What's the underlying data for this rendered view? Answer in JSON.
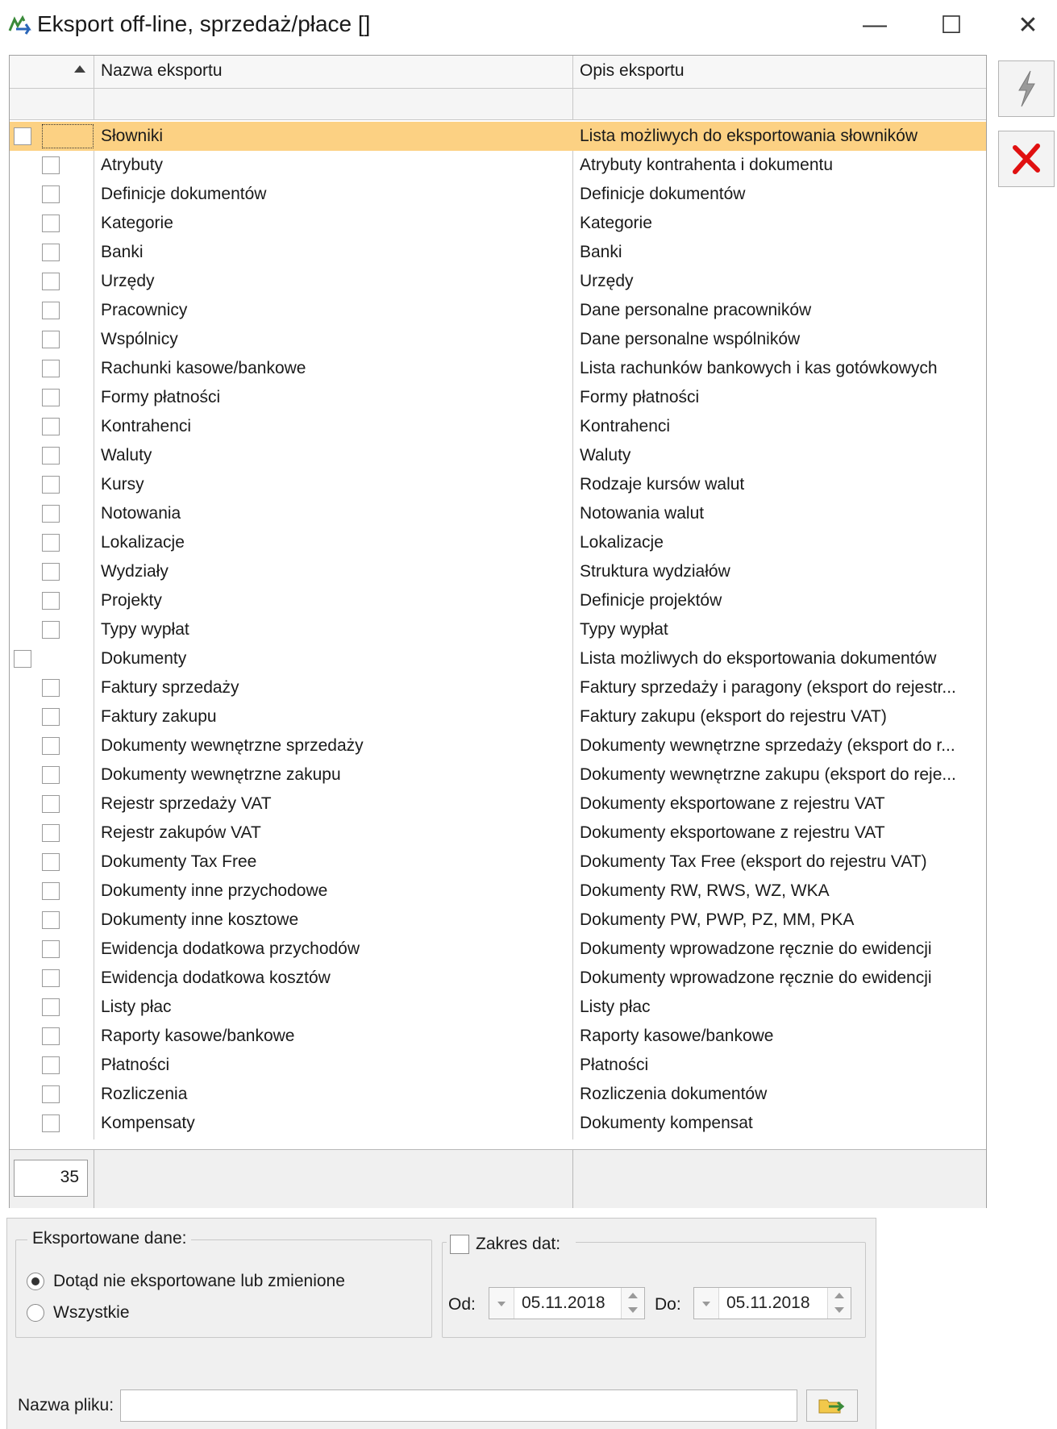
{
  "window": {
    "title": "Eksport off-line, sprzedaż/płace []",
    "minimize": "—",
    "maximize": "☐",
    "close": "✕"
  },
  "grid": {
    "columns": [
      "Nazwa eksportu",
      "Opis eksportu"
    ],
    "rows": [
      {
        "name": "Słowniki",
        "desc": "Lista możliwych do eksportowania słowników"
      },
      {
        "name": "Atrybuty",
        "desc": "Atrybuty kontrahenta i dokumentu"
      },
      {
        "name": "Definicje dokumentów",
        "desc": "Definicje dokumentów"
      },
      {
        "name": "Kategorie",
        "desc": "Kategorie"
      },
      {
        "name": "Banki",
        "desc": "Banki"
      },
      {
        "name": "Urzędy",
        "desc": "Urzędy"
      },
      {
        "name": "Pracownicy",
        "desc": "Dane personalne pracowników"
      },
      {
        "name": "Wspólnicy",
        "desc": "Dane personalne wspólników"
      },
      {
        "name": "Rachunki kasowe/bankowe",
        "desc": "Lista rachunków bankowych i kas gotówkowych"
      },
      {
        "name": "Formy płatności",
        "desc": "Formy płatności"
      },
      {
        "name": "Kontrahenci",
        "desc": "Kontrahenci"
      },
      {
        "name": "Waluty",
        "desc": "Waluty"
      },
      {
        "name": "Kursy",
        "desc": "Rodzaje kursów walut"
      },
      {
        "name": "Notowania",
        "desc": "Notowania walut"
      },
      {
        "name": "Lokalizacje",
        "desc": "Lokalizacje"
      },
      {
        "name": "Wydziały",
        "desc": "Struktura wydziałów"
      },
      {
        "name": "Projekty",
        "desc": "Definicje projektów"
      },
      {
        "name": "Typy wypłat",
        "desc": "Typy wypłat"
      },
      {
        "name": "Dokumenty",
        "desc": "Lista możliwych do eksportowania dokumentów"
      },
      {
        "name": "Faktury sprzedaży",
        "desc": "Faktury sprzedaży i paragony (eksport do rejestr..."
      },
      {
        "name": "Faktury zakupu",
        "desc": "Faktury zakupu  (eksport do rejestru VAT)"
      },
      {
        "name": "Dokumenty wewnętrzne sprzedaży",
        "desc": "Dokumenty wewnętrzne sprzedaży (eksport do r..."
      },
      {
        "name": "Dokumenty wewnętrzne zakupu",
        "desc": "Dokumenty wewnętrzne zakupu (eksport do reje..."
      },
      {
        "name": "Rejestr sprzedaży VAT",
        "desc": "Dokumenty eksportowane z rejestru VAT"
      },
      {
        "name": "Rejestr zakupów VAT",
        "desc": "Dokumenty eksportowane z rejestru VAT"
      },
      {
        "name": "Dokumenty Tax Free",
        "desc": "Dokumenty Tax Free (eksport do rejestru VAT)"
      },
      {
        "name": "Dokumenty inne przychodowe",
        "desc": "Dokumenty RW, RWS, WZ, WKA"
      },
      {
        "name": "Dokumenty inne kosztowe",
        "desc": "Dokumenty PW, PWP, PZ, MM, PKA"
      },
      {
        "name": "Ewidencja dodatkowa przychodów",
        "desc": "Dokumenty wprowadzone ręcznie do ewidencji"
      },
      {
        "name": "Ewidencja dodatkowa kosztów",
        "desc": "Dokumenty wprowadzone ręcznie do ewidencji"
      },
      {
        "name": "Listy płac",
        "desc": "Listy płac"
      },
      {
        "name": "Raporty kasowe/bankowe",
        "desc": "Raporty kasowe/bankowe"
      },
      {
        "name": "Płatności",
        "desc": "Płatności"
      },
      {
        "name": "Rozliczenia",
        "desc": "Rozliczenia dokumentów"
      },
      {
        "name": "Kompensaty",
        "desc": "Dokumenty kompensat"
      }
    ],
    "count": "35"
  },
  "exported": {
    "legend": "Eksportowane dane:",
    "option1": "Dotąd nie eksportowane lub zmienione",
    "option2": "Wszystkie"
  },
  "daterange": {
    "legend": "Zakres dat:",
    "from_label": "Od:",
    "from_value": "05.11.2018",
    "to_label": "Do:",
    "to_value": "05.11.2018"
  },
  "file": {
    "label": "Nazwa pliku:",
    "value": ""
  },
  "colors": {
    "selected_row": "#fcd183",
    "cancel_icon": "#e01010"
  }
}
